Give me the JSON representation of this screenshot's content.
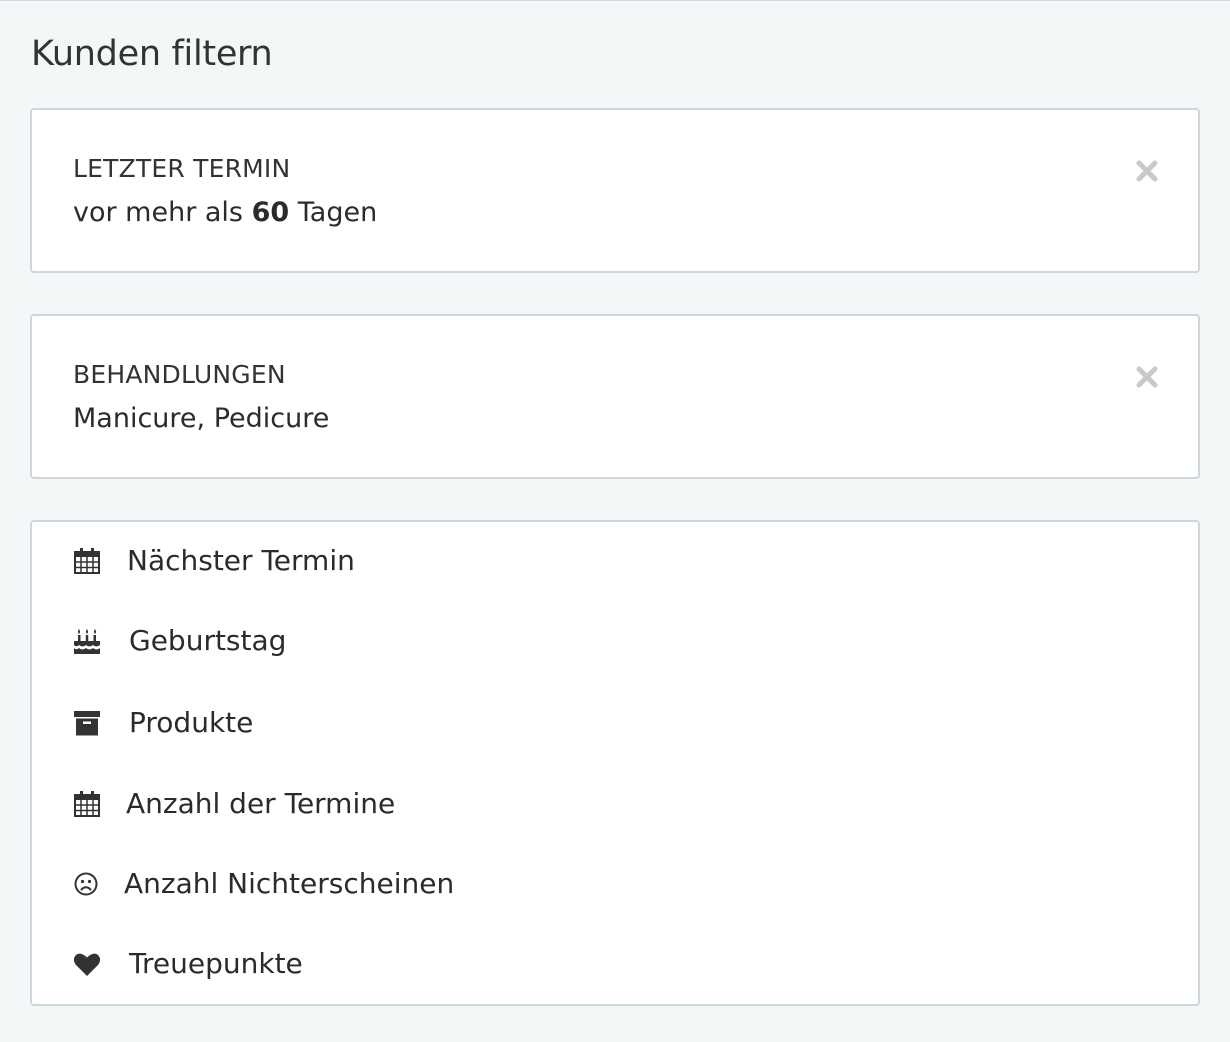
{
  "title": "Kunden filtern",
  "active_filters": [
    {
      "label": "LETZTER TERMIN",
      "value_prefix": "vor mehr als",
      "value_bold": "60",
      "value_suffix": "Tagen"
    },
    {
      "label": "BEHANDLUNGEN",
      "value": "Manicure, Pedicure"
    }
  ],
  "filter_options": [
    {
      "label": "Nächster Termin",
      "icon": "calendar-icon"
    },
    {
      "label": "Geburtstag",
      "icon": "birthday-cake-icon"
    },
    {
      "label": "Produkte",
      "icon": "archive-box-icon"
    },
    {
      "label": "Anzahl der Termine",
      "icon": "calendar-icon"
    },
    {
      "label": "Anzahl Nichterscheinen",
      "icon": "frown-face-icon"
    },
    {
      "label": "Treuepunkte",
      "icon": "heart-icon"
    }
  ],
  "colors": {
    "page_background": "#f3f7f7",
    "card_border": "#cbd7dc",
    "text": "#2b2b2b",
    "remove_icon": "#c9c9c9"
  }
}
